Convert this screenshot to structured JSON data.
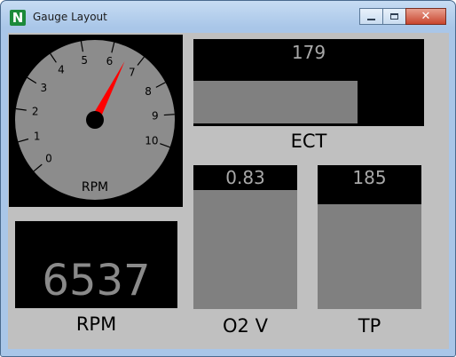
{
  "window": {
    "title": "Gauge Layout",
    "app_icon_letter": "N",
    "buttons": [
      "minimize",
      "maximize",
      "close"
    ]
  },
  "tachometer": {
    "label": "RPM",
    "ticks": [
      "0",
      "1",
      "2",
      "3",
      "4",
      "5",
      "6",
      "7",
      "8",
      "9",
      "10"
    ],
    "min": 0,
    "max": 10,
    "needle_value": 6.54
  },
  "ect": {
    "label": "ECT",
    "value": "179",
    "fill_fraction": 0.71
  },
  "rpm_digital": {
    "label": "RPM",
    "value": "6537"
  },
  "o2": {
    "label": "O2 V",
    "value": "0.83",
    "fill_fraction": 0.83
  },
  "tp": {
    "label": "TP",
    "value": "185",
    "fill_fraction": 0.73
  },
  "colors": {
    "background": "#c0c0c0",
    "panel": "#000000",
    "fill": "#808080",
    "value_text": "#a8a8a8",
    "needle": "#ff0000",
    "dial": "#8c8c8c"
  }
}
